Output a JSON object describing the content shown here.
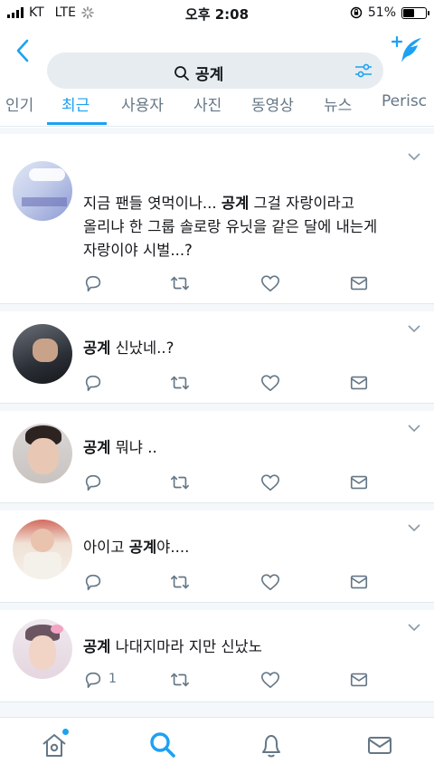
{
  "status_bar": {
    "carrier": "KT",
    "network": "LTE",
    "time": "오후 2:08",
    "battery_percent": "51%",
    "battery_level": 0.51
  },
  "search": {
    "query": "공계"
  },
  "tabs": [
    {
      "label": "인기",
      "active": false
    },
    {
      "label": "최근",
      "active": true
    },
    {
      "label": "사용자",
      "active": false
    },
    {
      "label": "사진",
      "active": false
    },
    {
      "label": "동영상",
      "active": false
    },
    {
      "label": "뉴스",
      "active": false
    },
    {
      "label": "Perisc",
      "active": false
    }
  ],
  "tweets": [
    {
      "lines": [
        [
          {
            "t": "지금 팬들 엿먹이나... ",
            "b": false
          },
          {
            "t": "공계",
            "b": true
          },
          {
            "t": " 그걸 자랑이라고",
            "b": false
          }
        ],
        [
          {
            "t": "올리냐 한 그룹 솔로랑 유닛을 같은 달에 내는게",
            "b": false
          }
        ],
        [
          {
            "t": "자랑이야 시벌...?",
            "b": false
          }
        ]
      ],
      "reply_count": ""
    },
    {
      "lines": [
        [
          {
            "t": "공계",
            "b": true
          },
          {
            "t": " 신났네..?",
            "b": false
          }
        ]
      ],
      "reply_count": ""
    },
    {
      "lines": [
        [
          {
            "t": "공계",
            "b": true
          },
          {
            "t": " 뭐냐 ..",
            "b": false
          }
        ]
      ],
      "reply_count": ""
    },
    {
      "lines": [
        [
          {
            "t": "아이고 ",
            "b": false
          },
          {
            "t": "공계",
            "b": true
          },
          {
            "t": "야....",
            "b": false
          }
        ]
      ],
      "reply_count": ""
    },
    {
      "lines": [
        [
          {
            "t": "공계",
            "b": true
          },
          {
            "t": " 나대지마라 지만 신났노",
            "b": false
          }
        ]
      ],
      "reply_count": "1"
    }
  ],
  "icons": {
    "back": "chevron-left-icon",
    "compose": "compose-tweet-icon",
    "search": "search-icon",
    "filter": "filter-sliders-icon",
    "reply": "reply-icon",
    "retweet": "retweet-icon",
    "like": "heart-icon",
    "dm": "envelope-icon",
    "home": "home-icon",
    "notifications": "bell-icon",
    "messages": "envelope-icon"
  },
  "colors": {
    "accent": "#1da1f2",
    "icon_gray": "#657786",
    "search_bg": "#e6ecf0"
  }
}
